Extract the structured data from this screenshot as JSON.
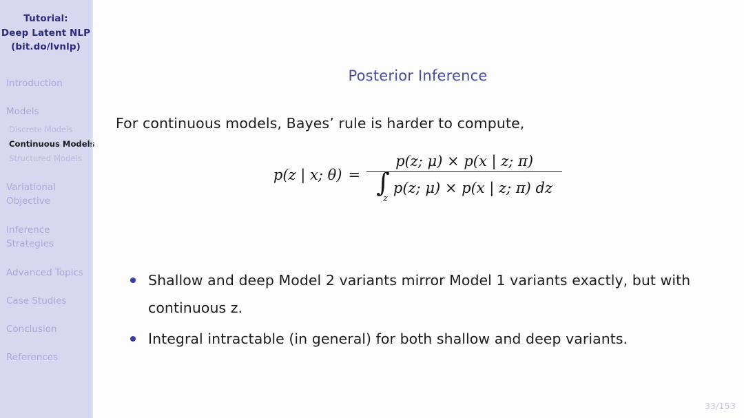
{
  "sidebar": {
    "title_lines": [
      "Tutorial:",
      "Deep Latent NLP",
      "(bit.do/lvnlp)"
    ],
    "sections": [
      {
        "label": "Introduction",
        "active": false,
        "subitems": []
      },
      {
        "label": "Models",
        "active": false,
        "subitems": [
          {
            "label": "Discrete Models",
            "active": false
          },
          {
            "label": "Continuous Models",
            "active": true
          },
          {
            "label": "Structured Models",
            "active": false
          }
        ]
      },
      {
        "label": "Variational Objective",
        "active": false,
        "subitems": []
      },
      {
        "label": "Inference Strategies",
        "active": false,
        "subitems": []
      },
      {
        "label": "Advanced Topics",
        "active": false,
        "subitems": []
      },
      {
        "label": "Case Studies",
        "active": false,
        "subitems": []
      },
      {
        "label": "Conclusion",
        "active": false,
        "subitems": []
      },
      {
        "label": "References",
        "active": false,
        "subitems": []
      }
    ],
    "colors": {
      "background": "#d7d7ef",
      "title_text": "#2b2b7e",
      "section_text": "#a9a9d8",
      "subitem_text": "#b9b9dd",
      "subitem_active_text": "#1a1a1a"
    }
  },
  "slide": {
    "title": "Posterior Inference",
    "lead_text": "For continuous models, Bayes’ rule is harder to compute,",
    "formula": {
      "lhs": "p(z | x; θ)",
      "equals": "=",
      "numerator": "p(z; μ) × p(x | z; π)",
      "integral_sign": "∫",
      "integral_subscript": "z",
      "denominator": "p(z; μ) × p(x | z; π) dz"
    },
    "bullets": [
      "Shallow and deep Model 2 variants mirror Model 1 variants exactly, but with continuous z.",
      "Integral intractable (in general) for both shallow and deep variants."
    ],
    "page_number": "33/153",
    "colors": {
      "title_text": "#4b4ba0",
      "body_text": "#1b1b1b",
      "bullet_marker": "#3b3bab",
      "page_number_text": "#c3c3e2",
      "background": "#fdfdfd"
    }
  }
}
